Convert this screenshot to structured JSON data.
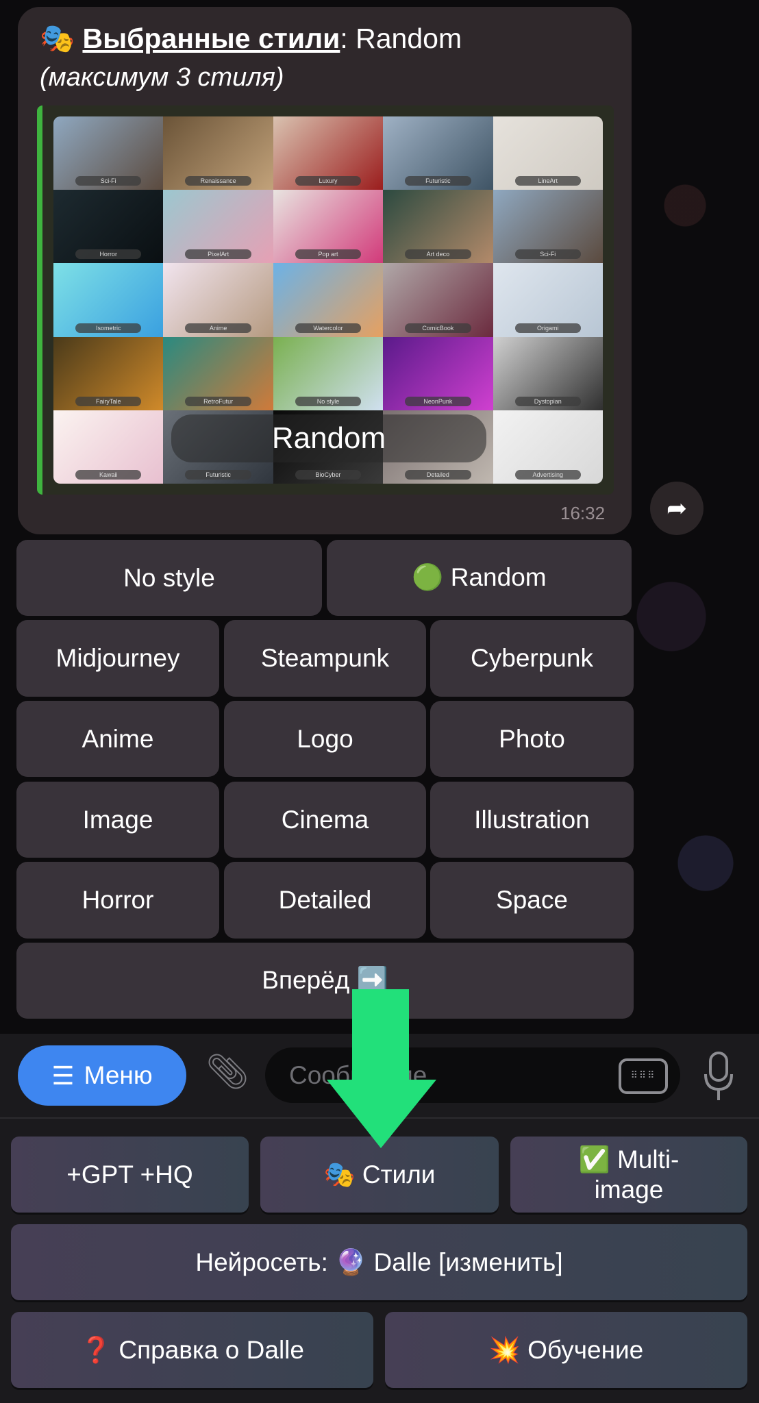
{
  "message": {
    "title_emoji": "🎭",
    "title_label": "Выбранные стили",
    "title_value": ": Random",
    "subtitle": "(максимум 3 стиля)",
    "time": "16:32",
    "preview": {
      "overlay_text": "Random",
      "tiles": [
        "Sci-Fi",
        "Renaissance",
        "Luxury",
        "Futuristic",
        "LineArt",
        "Horror",
        "PixelArt",
        "Pop art",
        "Art deco",
        "Sci-Fi",
        "Isometric",
        "Anime",
        "Watercolor",
        "ComicBook",
        "Origami",
        "FairyTale",
        "RetroFutur",
        "No style",
        "NeonPunk",
        "Dystopian",
        "Kawaii",
        "Futuristic",
        "BioCyber",
        "Detailed",
        "Advertising"
      ]
    }
  },
  "inline_keyboard": [
    [
      "No style",
      "🟢 Random"
    ],
    [
      "Midjourney",
      "Steampunk",
      "Cyberpunk"
    ],
    [
      "Anime",
      "Logo",
      "Photo"
    ],
    [
      "Image",
      "Cinema",
      "Illustration"
    ],
    [
      "Horror",
      "Detailed",
      "Space"
    ],
    [
      "Вперёд ➡️"
    ]
  ],
  "composer": {
    "menu_label": "Меню",
    "placeholder": "Сообщение"
  },
  "reply_keyboard": {
    "gpt_hq": "+GPT +HQ",
    "styles": "🎭 Стили",
    "multi_image": "✅ Multi-image",
    "network": "Нейросеть: 🔮 Dalle [изменить]",
    "help": "❓ Справка о Dalle",
    "training": "💥 Обучение"
  },
  "colors": {
    "accent": "#3e86f0",
    "arrow": "#22e07a",
    "quote_bar": "#3fb43f"
  }
}
